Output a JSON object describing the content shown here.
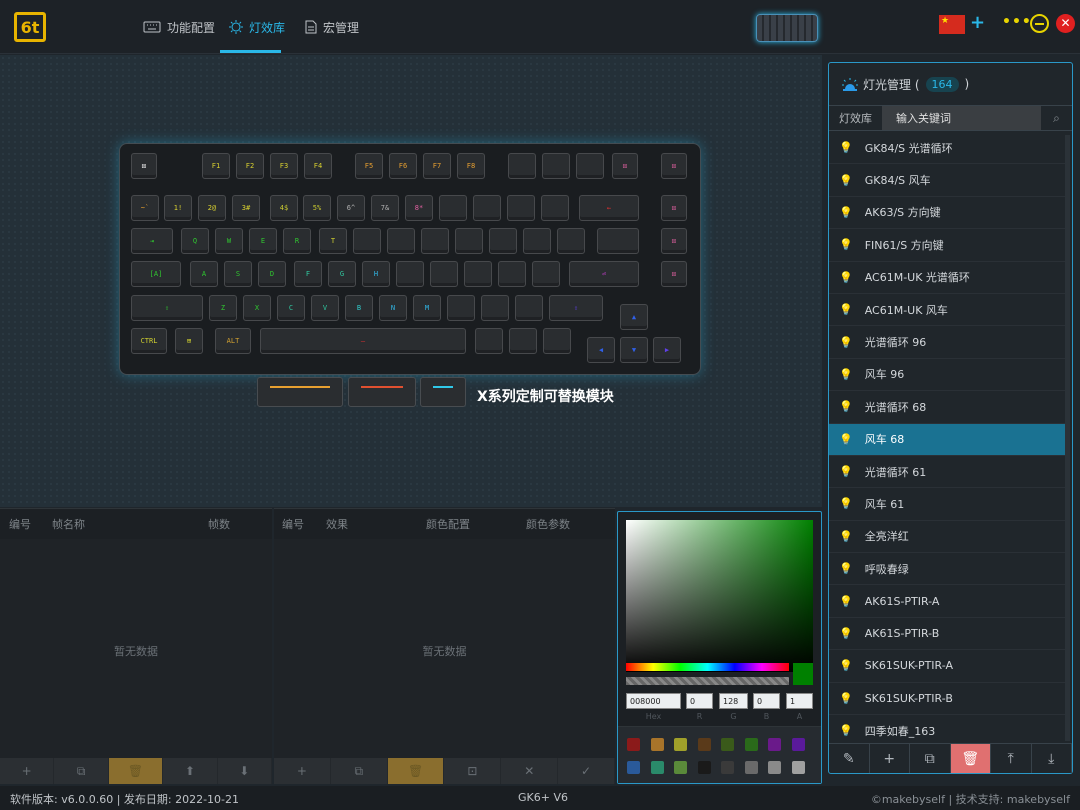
{
  "topbar": {
    "logo_text": "6t",
    "tabs": [
      {
        "label": "功能配置",
        "icon": "keyboard-icon"
      },
      {
        "label": "灯效库",
        "icon": "lighting-icon"
      },
      {
        "label": "宏管理",
        "icon": "document-icon"
      }
    ],
    "active_tab": "灯效库",
    "flag_icon": "china-flag-icon"
  },
  "keyboard": {
    "row0": [
      "F1",
      "F2",
      "F3",
      "F4",
      "F5",
      "F6",
      "F7",
      "F8"
    ],
    "row1": [
      "~`",
      "1!",
      "2@",
      "3#",
      "4$",
      "5%",
      "6^",
      "7&",
      "8*"
    ],
    "row2": [
      "Q",
      "W",
      "E",
      "R",
      "T"
    ],
    "row3": [
      "[A]",
      "A",
      "S",
      "D",
      "F",
      "G",
      "H"
    ],
    "row4": [
      "Z",
      "X",
      "C",
      "V",
      "B",
      "N",
      "M"
    ],
    "row5": [
      "CTRL",
      "ALT"
    ]
  },
  "module_caption": "X系列定制可替换模块",
  "light_panel": {
    "title": "灯光管理 (",
    "count": "164",
    "close_paren": ")",
    "tab": "灯效库",
    "search_value": "输入关键词",
    "items": [
      "GK84/S 光谱循环",
      "GK84/S 风车",
      "AK63/S 方向键",
      "FIN61/S 方向键",
      "AC61M-UK 光谱循环",
      "AC61M-UK 风车",
      "光谱循环 96",
      "风车 96",
      "光谱循环 68",
      "风车 68",
      "光谱循环 61",
      "风车 61",
      "全亮洋红",
      "呼吸春绿",
      "AK61S-PTIR-A",
      "AK61S-PTIR-B",
      "SK61SUK-PTIR-A",
      "SK61SUK-PTIR-B",
      "四季如春_163"
    ],
    "selected": "风车 68"
  },
  "frames_panel": {
    "headers": [
      "编号",
      "帧名称",
      "帧数"
    ],
    "empty": "暂无数据"
  },
  "effects_panel": {
    "headers": [
      "编号",
      "效果",
      "颜色配置",
      "颜色参数"
    ],
    "empty": "暂无数据"
  },
  "color_picker": {
    "hex": "008000",
    "r": "0",
    "g": "128",
    "b": "0",
    "a": "1",
    "labels": [
      "Hex",
      "R",
      "G",
      "B",
      "A"
    ],
    "presets": [
      "#8b1a1a",
      "#a8742a",
      "#a0a02a",
      "#5a3a1a",
      "#3a5a1a",
      "#2a6a1a",
      "#6a1a8a",
      "#5a1a9a",
      "#2a5a9a",
      "#2a8a6a",
      "#5a8a3a",
      "#1a1a1a",
      "#3a3a3a",
      "#6a6a6a",
      "#8a8a8a",
      "#a0a0a0"
    ]
  },
  "status": {
    "left": "软件版本: v6.0.0.60 | 发布日期: 2022-10-21",
    "center": "GK6+ V6",
    "right": "©makebyself | 技术支持: makebyself"
  },
  "colors": {
    "accent": "#2ab8e8",
    "selected_row": "#1a7292",
    "warn": "#e8d400",
    "delete": "#e07070"
  }
}
